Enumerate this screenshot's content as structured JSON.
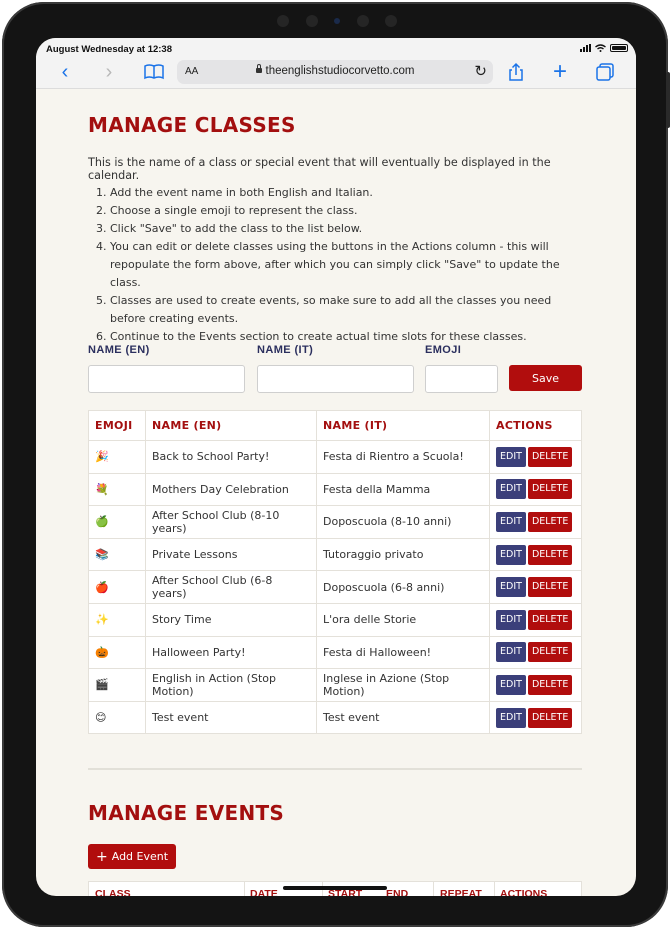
{
  "status_bar": {
    "time": "August Wednesday at 12:38"
  },
  "browser": {
    "text_size_label": "AA",
    "url": "theenglishstudiocorvetto.com"
  },
  "manage_classes": {
    "title": "MANAGE CLASSES",
    "intro": "This is the name of a class or special event that will eventually be displayed in the calendar.",
    "steps": [
      "Add the event name in both English and Italian.",
      "Choose a single emoji to represent the class.",
      "Click \"Save\" to add the class to the list below.",
      "You can edit or delete classes using the buttons in the Actions column - this will repopulate the form above, after which you can simply click \"Save\" to update the class.",
      "Classes are used to create events, so make sure to add all the classes you need before creating events.",
      "Continue to the Events section to create actual time slots for these classes."
    ],
    "form": {
      "name_en_label": "NAME (EN)",
      "name_it_label": "NAME (IT)",
      "emoji_label": "EMOJI",
      "name_en_value": "",
      "name_it_value": "",
      "emoji_value": "",
      "save_label": "Save"
    },
    "table": {
      "columns": [
        "EMOJI",
        "NAME (EN)",
        "NAME (IT)",
        "ACTIONS"
      ],
      "edit_label": "EDIT",
      "delete_label": "DELETE",
      "rows": [
        {
          "emoji": "🎉",
          "name_en": "Back to School Party!",
          "name_it": "Festa di Rientro a Scuola!"
        },
        {
          "emoji": "💐",
          "name_en": "Mothers Day Celebration",
          "name_it": "Festa della Mamma"
        },
        {
          "emoji": "🍏",
          "name_en": "After School Club (8-10 years)",
          "name_it": "Doposcuola (8-10 anni)"
        },
        {
          "emoji": "📚",
          "name_en": "Private Lessons",
          "name_it": "Tutoraggio privato"
        },
        {
          "emoji": "🍎",
          "name_en": "After School Club (6-8 years)",
          "name_it": "Doposcuola (6-8 anni)"
        },
        {
          "emoji": "✨",
          "name_en": "Story Time",
          "name_it": "L'ora delle Storie"
        },
        {
          "emoji": "🎃",
          "name_en": "Halloween Party!",
          "name_it": "Festa di Halloween!"
        },
        {
          "emoji": "🎬",
          "name_en": "English in Action (Stop Motion)",
          "name_it": "Inglese in Azione (Stop Motion)"
        },
        {
          "emoji": "😊",
          "name_en": "Test event",
          "name_it": "Test event"
        }
      ]
    }
  },
  "manage_events": {
    "title": "MANAGE EVENTS",
    "add_label": "Add Event",
    "columns": [
      "CLASS",
      "DATE",
      "START",
      "END",
      "REPEAT",
      "ACTIONS"
    ]
  },
  "icons": [
    "back-icon",
    "forward-icon",
    "bookmarks-icon",
    "lock-icon",
    "reload-icon",
    "share-icon",
    "new-tab-icon",
    "tabs-icon",
    "plus-icon"
  ]
}
